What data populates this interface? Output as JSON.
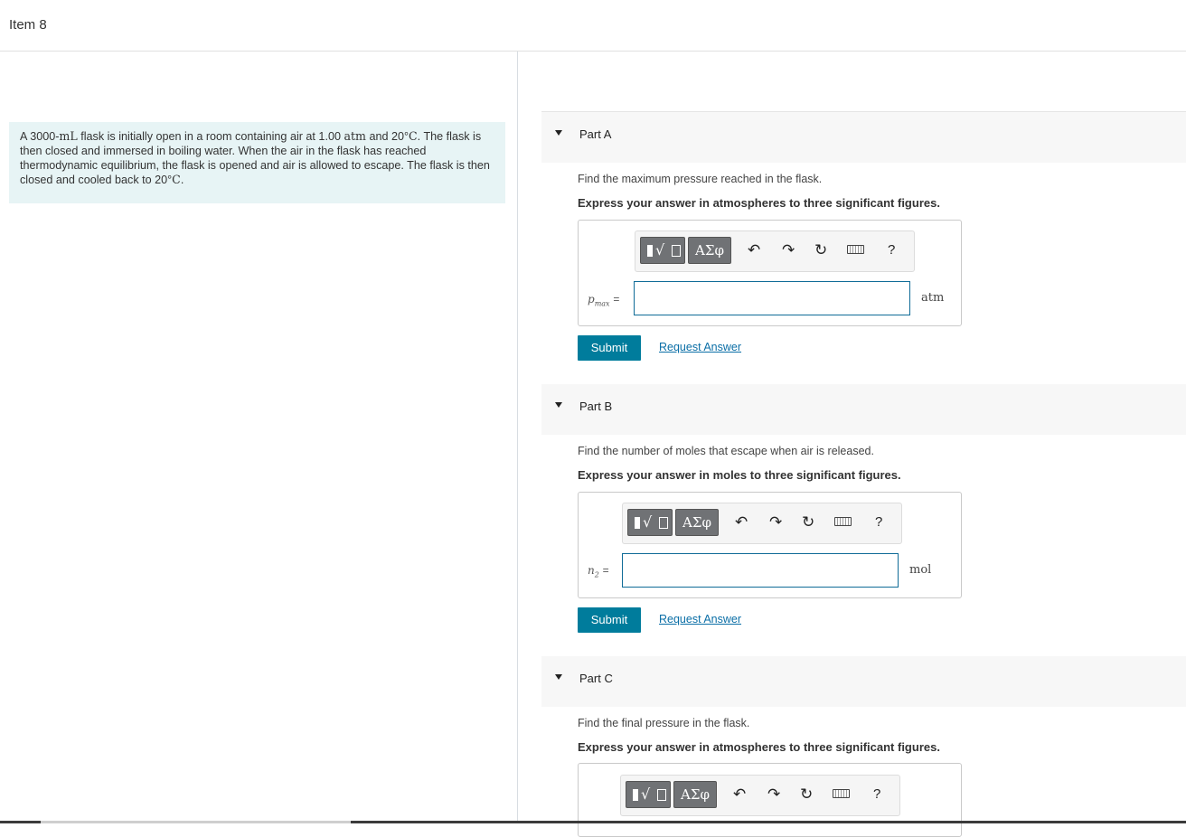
{
  "header": {
    "title": "Item 8"
  },
  "problem": {
    "text_1": "A 3000-",
    "unit_ml": "mL",
    "text_2": " flask is initially open in a room containing air at 1.00 ",
    "unit_atm": "atm",
    "text_3": " and 20°",
    "unit_c1": "C",
    "text_4": ". The flask is then closed and immersed in boiling water. When the air in the flask has reached thermodynamic equilibrium, the flask is opened and air is allowed to escape. The flask is then closed and cooled back to 20°",
    "unit_c2": "C",
    "text_5": "."
  },
  "toolbar": {
    "greek_label": "ΑΣφ",
    "radical_glyph": "√",
    "help_label": "?",
    "undo_glyph": "↶",
    "redo_glyph": "↷",
    "reset_glyph": "↻"
  },
  "parts": [
    {
      "label": "Part A",
      "prompt": "Find the maximum pressure reached in the flask.",
      "instruction": "Express your answer in atmospheres to three significant figures.",
      "var_main": "p",
      "var_sub": "max",
      "equals": "=",
      "value": "",
      "unit": "atm",
      "submit_label": "Submit",
      "request_label": "Request Answer"
    },
    {
      "label": "Part B",
      "prompt": "Find the number of moles that escape when air is released.",
      "instruction": "Express your answer in moles to three significant figures.",
      "var_main": "n",
      "var_sub": "2",
      "equals": "=",
      "value": "",
      "unit": "mol",
      "submit_label": "Submit",
      "request_label": "Request Answer"
    },
    {
      "label": "Part C",
      "prompt": "Find the final pressure in the flask.",
      "instruction": "Express your answer in atmospheres to three significant figures."
    }
  ]
}
